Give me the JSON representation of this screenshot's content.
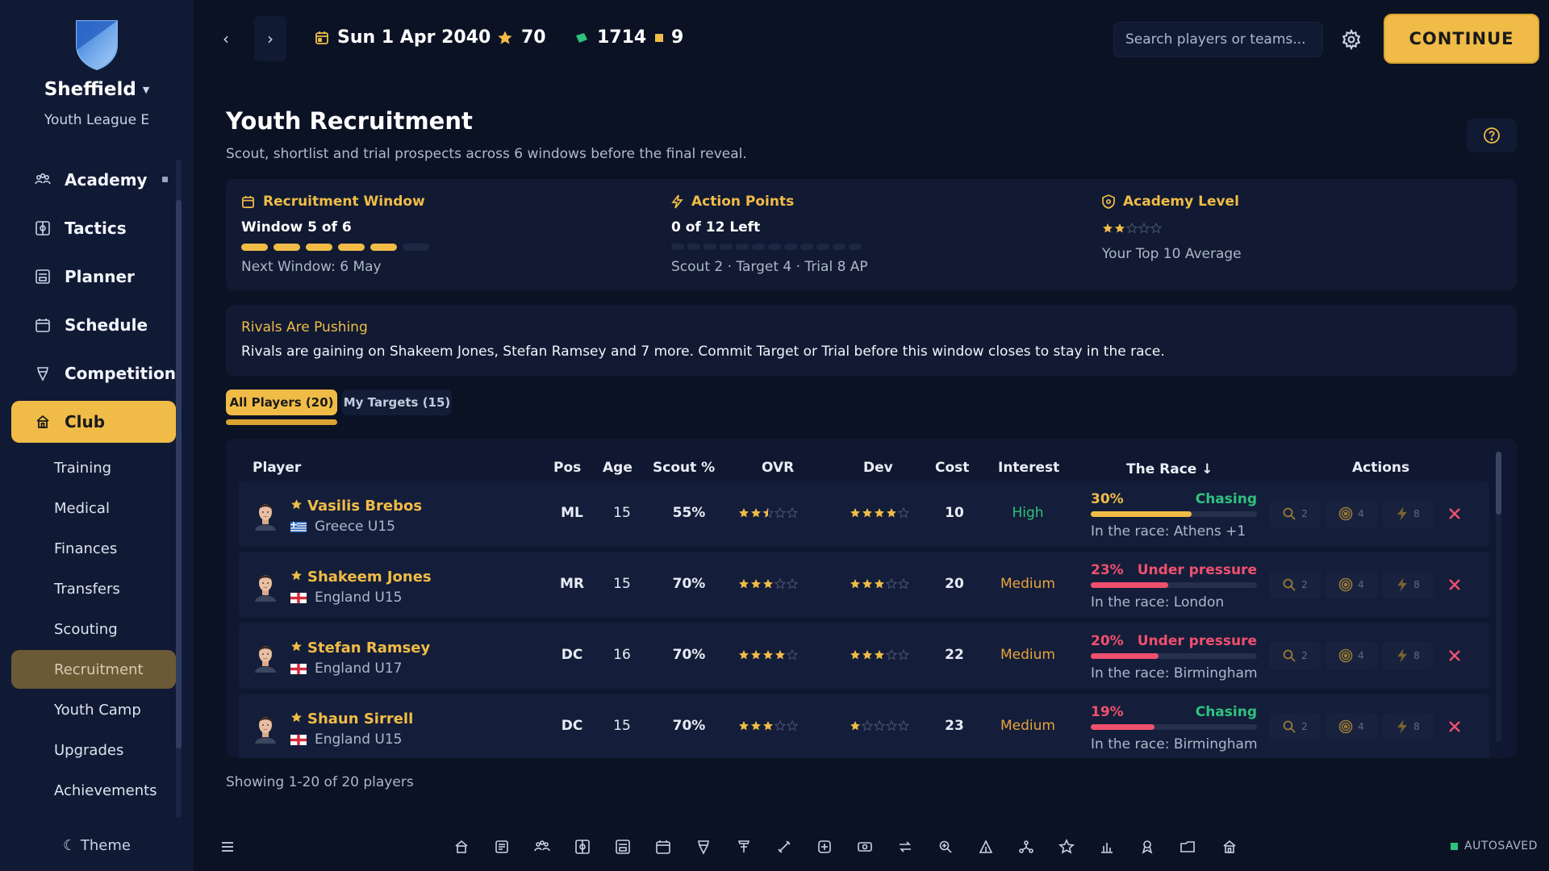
{
  "club": {
    "name": "Sheffield",
    "league": "Youth League E"
  },
  "sidebar": {
    "items": [
      {
        "label": "Academy",
        "icon": "academy-icon",
        "active": false
      },
      {
        "label": "Tactics",
        "icon": "tactics-icon",
        "active": false
      },
      {
        "label": "Planner",
        "icon": "planner-icon",
        "active": false
      },
      {
        "label": "Schedule",
        "icon": "calendar-icon",
        "active": false
      },
      {
        "label": "Competition",
        "icon": "trophy-icon",
        "active": false
      },
      {
        "label": "Club",
        "icon": "club-icon",
        "active": true
      }
    ],
    "subitems": [
      "Training",
      "Medical",
      "Finances",
      "Transfers",
      "Scouting",
      "Recruitment",
      "Youth Camp",
      "Upgrades",
      "Achievements"
    ],
    "active_subitem": "Recruitment",
    "theme_label": "☾ Theme"
  },
  "topbar": {
    "back": "‹",
    "forward": "›",
    "date": "Sun 1 Apr 2040",
    "stars": "70",
    "cash": "1714",
    "tokens": "9",
    "search_placeholder": "Search players or teams...",
    "continue_label": "CONTINUE"
  },
  "page": {
    "title": "Youth Recruitment",
    "subtitle": "Scout, shortlist and trial prospects across 6 windows before the final reveal."
  },
  "info": {
    "window": {
      "label": "Recruitment Window",
      "value": "Window 5 of 6",
      "sub": "Next Window: 6 May",
      "filled": 5,
      "total": 6
    },
    "ap": {
      "label": "Action Points",
      "value": "0 of 12 Left",
      "sub": "Scout 2 · Target 4 · Trial 8 AP",
      "filled": 0,
      "total": 12
    },
    "academy": {
      "label": "Academy Level",
      "sub": "Your Top 10 Average",
      "stars": 2
    }
  },
  "rivals": {
    "title": "Rivals Are Pushing",
    "text": "Rivals are gaining on Shakeem Jones, Stefan Ramsey and 7 more. Commit Target or Trial before this window closes to stay in the race."
  },
  "tabs": [
    {
      "label": "All Players (20)",
      "active": true
    },
    {
      "label": "My Targets (15)",
      "active": false
    }
  ],
  "table": {
    "headers": {
      "player": "Player",
      "pos": "Pos",
      "age": "Age",
      "scout": "Scout %",
      "ovr": "OVR",
      "dev": "Dev",
      "cost": "Cost",
      "interest": "Interest",
      "race": "The Race ↓",
      "actions": "Actions"
    },
    "rows": [
      {
        "name": "Vasilis Brebos",
        "nation": "Greece U15",
        "flag": "greece",
        "pos": "ML",
        "age": "15",
        "scout": "55%",
        "ovr": 2.5,
        "dev": 4,
        "cost": "10",
        "interest": "High",
        "race_pct": "30%",
        "race_value": 30,
        "race_status": "Chasing",
        "race_color": "#f0bc47",
        "status_color": "#2ec27e",
        "race_text": "In the race: Athens +1",
        "scout_ap": "2",
        "target_ap": "4",
        "trial_ap": "8"
      },
      {
        "name": "Shakeem Jones",
        "nation": "England U15",
        "flag": "england",
        "pos": "MR",
        "age": "15",
        "scout": "70%",
        "ovr": 3,
        "dev": 3,
        "cost": "20",
        "interest": "Medium",
        "race_pct": "23%",
        "race_value": 23,
        "race_status": "Under pressure",
        "race_color": "#f0506e",
        "status_color": "#f0506e",
        "race_text": "In the race: London",
        "scout_ap": "2",
        "target_ap": "4",
        "trial_ap": "8"
      },
      {
        "name": "Stefan Ramsey",
        "nation": "England U17",
        "flag": "england",
        "pos": "DC",
        "age": "16",
        "scout": "70%",
        "ovr": 4,
        "dev": 3,
        "cost": "22",
        "interest": "Medium",
        "race_pct": "20%",
        "race_value": 20,
        "race_status": "Under pressure",
        "race_color": "#f0506e",
        "status_color": "#f0506e",
        "race_text": "In the race: Birmingham +",
        "scout_ap": "2",
        "target_ap": "4",
        "trial_ap": "8"
      },
      {
        "name": "Shaun Sirrell",
        "nation": "England U15",
        "flag": "england",
        "pos": "DC",
        "age": "15",
        "scout": "70%",
        "ovr": 3,
        "dev": 1,
        "cost": "23",
        "interest": "Medium",
        "race_pct": "19%",
        "race_value": 19,
        "race_status": "Chasing",
        "race_color": "#f0506e",
        "status_color": "#2ec27e",
        "race_text": "In the race: Birmingham",
        "scout_ap": "2",
        "target_ap": "4",
        "trial_ap": "8"
      }
    ],
    "showing": "Showing 1-20 of 20 players"
  },
  "bottom": {
    "menu_icon": "menu-icon",
    "icons": [
      "home-icon",
      "news-icon",
      "academy-icon",
      "tactics-icon",
      "planner-icon",
      "calendar-icon",
      "trophy-icon",
      "training-icon",
      "medical-icon",
      "finances-icon",
      "transfers-icon",
      "scouting-icon",
      "recruitment-icon",
      "youth-camp-icon",
      "upgrades-icon",
      "stats-icon",
      "achievements-icon",
      "files-icon",
      "club-icon"
    ],
    "autosaved": "AUTOSAVED"
  },
  "colors": {
    "accent": "#f0bc47",
    "background": "#0b1224",
    "sidebar": "#101a35",
    "success": "#2ec27e",
    "danger": "#f0506e"
  }
}
